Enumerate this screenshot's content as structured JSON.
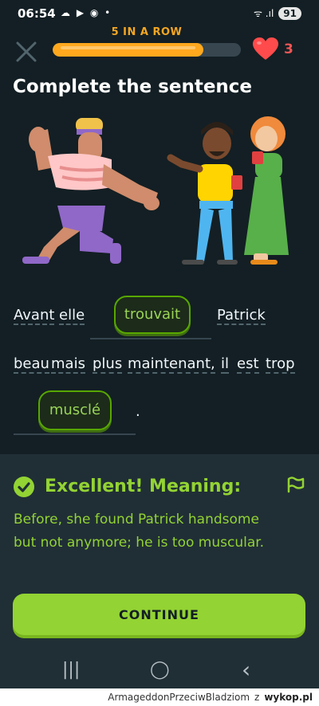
{
  "status_bar": {
    "time": "06:54",
    "left_icons": "☁ ▶ ◉ •",
    "signal": "ᯤ .ıl",
    "battery": "91"
  },
  "header": {
    "streak_label": "5 IN A ROW",
    "progress_fraction": 0.8,
    "hearts": "3"
  },
  "exercise": {
    "title": "Complete the sentence",
    "words": [
      "Avant",
      "elle",
      "Patrick",
      "beau",
      "mais",
      "plus",
      "maintenant,",
      "il",
      "est",
      "trop",
      "."
    ],
    "chips": [
      "trouvait",
      "musclé"
    ]
  },
  "feedback": {
    "heading": "Excellent! Meaning:",
    "meaning": "Before, she found Patrick handsome but not anymore; he is too muscular."
  },
  "continue_label": "CONTINUE",
  "nav": {
    "recents": "|||",
    "home": "◯",
    "back": "‹"
  },
  "watermark": {
    "user": "ArmageddonPrzeciwBladziom",
    "sep": "z",
    "site": "wykop.pl"
  },
  "colors": {
    "background": "#131f24",
    "accent": "#93d333",
    "streak": "#ffa81e",
    "heart": "#ee5555"
  }
}
